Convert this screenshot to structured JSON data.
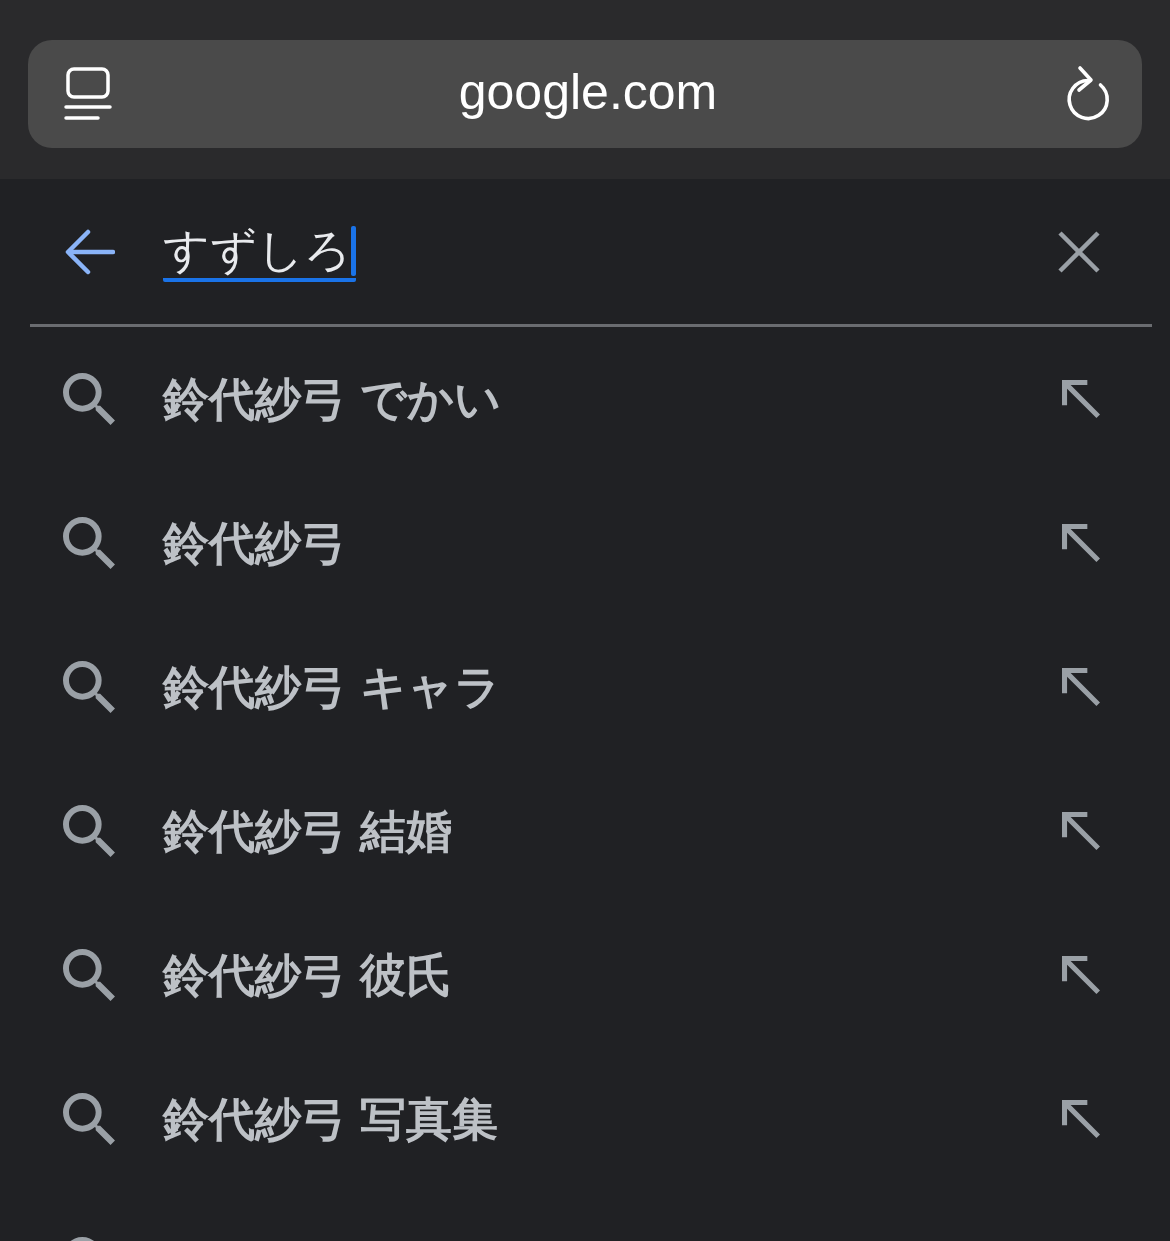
{
  "address_bar": {
    "url": "google.com"
  },
  "search": {
    "value": "すずしろ",
    "composing": true
  },
  "suggestions": [
    {
      "text": "鈴代紗弓 でかい"
    },
    {
      "text": "鈴代紗弓"
    },
    {
      "text": "鈴代紗弓 キャラ"
    },
    {
      "text": "鈴代紗弓 結婚"
    },
    {
      "text": "鈴代紗弓 彼氏"
    },
    {
      "text": "鈴代紗弓 写真集"
    }
  ]
}
